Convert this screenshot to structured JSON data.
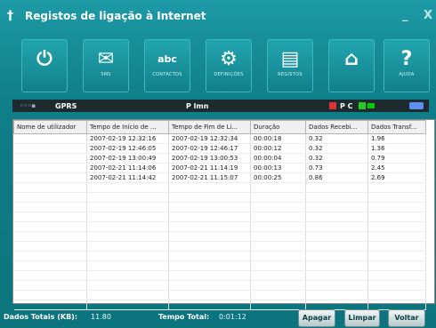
{
  "window": {
    "title": "Registos de ligação à Internet",
    "logo_glyph": "†",
    "minimize_glyph": "_",
    "close_glyph": "X"
  },
  "toolbar": [
    {
      "name": "power",
      "icon_glyph": "⏻",
      "label": ""
    },
    {
      "name": "sms",
      "icon_glyph": "✉",
      "label": "SMS"
    },
    {
      "name": "contactos",
      "icon_glyph": "abc",
      "label": "CONTACTOS"
    },
    {
      "name": "definicoes",
      "icon_glyph": "⚙",
      "label": "DEFINIÇÕES"
    },
    {
      "name": "registos",
      "icon_glyph": "▤",
      "label": "REGISTOS"
    },
    {
      "name": "home",
      "icon_glyph": "⌂",
      "label": ""
    },
    {
      "name": "ajuda",
      "icon_glyph": "?",
      "label": "AJUDA"
    }
  ],
  "statusbar": {
    "signal": "◦◦◦▪",
    "network": "GPRS",
    "operator": "P lmn",
    "pc_label": "P C",
    "colors": {
      "background": "#1d2a2e",
      "battery": "#5c8ff0"
    }
  },
  "table": {
    "headers": [
      "Nome de utilizador",
      "Tempo de Início de ...",
      "Tempo de Fim de Li...",
      "Duração",
      "Dados Recebi...",
      "Dados Transf..."
    ],
    "rows": [
      [
        "",
        "2007-02-19 12:32:16",
        "2007-02-19 12:32:34",
        "00:00:18",
        "0.32",
        "1.96"
      ],
      [
        "",
        "2007-02-19 12:46:05",
        "2007-02-19 12:46:17",
        "00:00:12",
        "0.32",
        "1.36"
      ],
      [
        "",
        "2007-02-19 13:00:49",
        "2007-02-19 13:00:53",
        "00:00:04",
        "0.32",
        "0.79"
      ],
      [
        "",
        "2007-02-21 11:14:06",
        "2007-02-21 11:14:19",
        "00:00:13",
        "0.73",
        "2.45"
      ],
      [
        "",
        "2007-02-21 11:14:42",
        "2007-02-21 11:15:07",
        "00:00:25",
        "0.86",
        "2.69"
      ]
    ]
  },
  "footer": {
    "data_label": "Dados Totais (KB):",
    "data_value": "11.80",
    "time_label": "Tempo Total:",
    "time_value": "0:01:12",
    "buttons": {
      "apagar": "Apagar",
      "limpar": "Limpar",
      "voltar": "Voltar"
    }
  }
}
